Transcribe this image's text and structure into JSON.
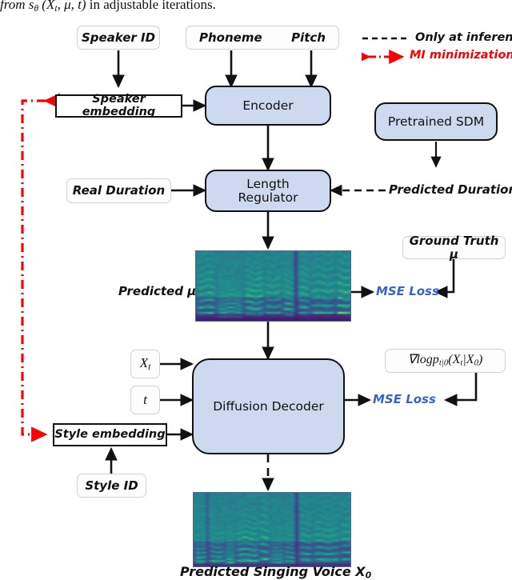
{
  "caption": {
    "text_prefix": "from s",
    "text_theta": "θ",
    "text_args": " (X",
    "text_t": "t",
    "text_mu": ", μ, t) in adjustable iterations."
  },
  "legend": {
    "dashed_label": "Only at inference",
    "mi_label": "MI minimization",
    "mi_color": "#ff0000",
    "dashed_color": "#111111"
  },
  "nodes": {
    "speaker_id": "Speaker ID",
    "phoneme": "Phoneme",
    "pitch": "Pitch",
    "speaker_embedding": "Speaker embedding",
    "encoder": "Encoder",
    "pretrained_sdm": "Pretrained SDM",
    "real_duration": "Real Duration",
    "length_regulator_line1": "Length",
    "length_regulator_line2": "Regulator",
    "predicted_duration": "Predicted Duration",
    "predicted_mu": "Predicted μ",
    "ground_truth_mu": "Ground Truth μ",
    "mse_loss_top": "MSE Loss",
    "xt": "X",
    "xt_sub": "t",
    "t": "t",
    "style_embedding": "Style embedding",
    "style_id": "Style ID",
    "diffusion_decoder": "Diffusion Decoder",
    "score_target": "∇logp",
    "score_target_sub": "t|0",
    "score_target_args": "(X",
    "score_target_args_sub": "t",
    "score_target_args_mid": "|X",
    "score_target_args_sub2": "0",
    "score_target_args_end": ")",
    "mse_loss_bottom": "MSE Loss",
    "predicted_voice_label": "Predicted Singing Voice X",
    "predicted_voice_sub": "0"
  },
  "colors": {
    "block_fill": "#ccd9ef",
    "block_stroke": "#111111",
    "chip_stroke": "#d2d2d2",
    "mse_blue": "#3a63c8",
    "mi_red": "#ff0000"
  },
  "spectrograms": {
    "predicted_mu": {
      "name": "predicted-mu-spectrogram",
      "colormap": "viridis",
      "seed": 11,
      "bands": 38,
      "frames": 96
    },
    "predicted_voice": {
      "name": "predicted-singing-voice-spectrogram",
      "colormap": "viridis",
      "seed": 29,
      "bands": 44,
      "frames": 96
    }
  }
}
